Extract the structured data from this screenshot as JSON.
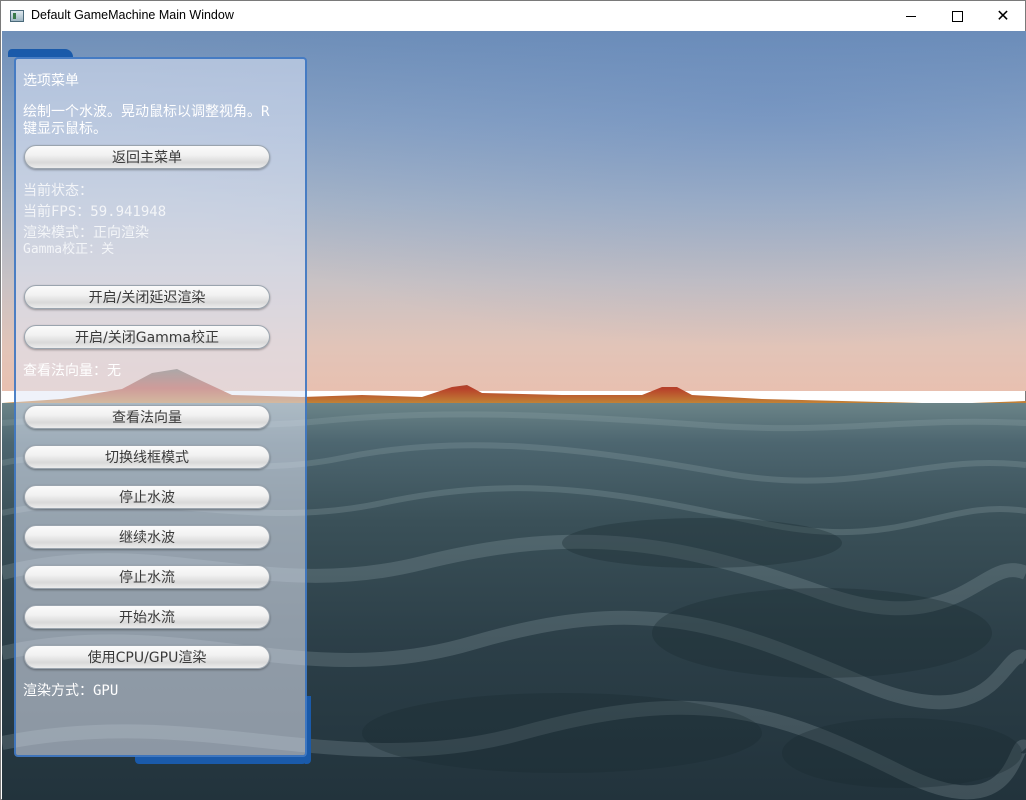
{
  "window": {
    "title": "Default GameMachine Main Window",
    "controls": {
      "minimize": "minimize",
      "maximize": "maximize",
      "close": "✕"
    }
  },
  "panel": {
    "heading": "选项菜单",
    "description": "绘制一个水波。晃动鼠标以调整视角。R键显示鼠标。",
    "back_button": "返回主菜单",
    "status_heading": "当前状态：",
    "fps": "当前FPS：59.941948",
    "render_mode": "渲染模式：正向渲染",
    "gamma": "Gamma校正：关",
    "toggle_deferred_button": "开启/关闭延迟渲染",
    "toggle_gamma_button": "开启/关闭Gamma校正",
    "normals_status": "查看法向量：无",
    "buttons": [
      "查看法向量",
      "切换线框模式",
      "停止水波",
      "继续水波",
      "停止水流",
      "开始水流",
      "使用CPU/GPU渲染"
    ],
    "render_method": "渲染方式：GPU"
  },
  "colors": {
    "panel_border": "#326ebe",
    "panel_tab": "#1a5aaa"
  }
}
